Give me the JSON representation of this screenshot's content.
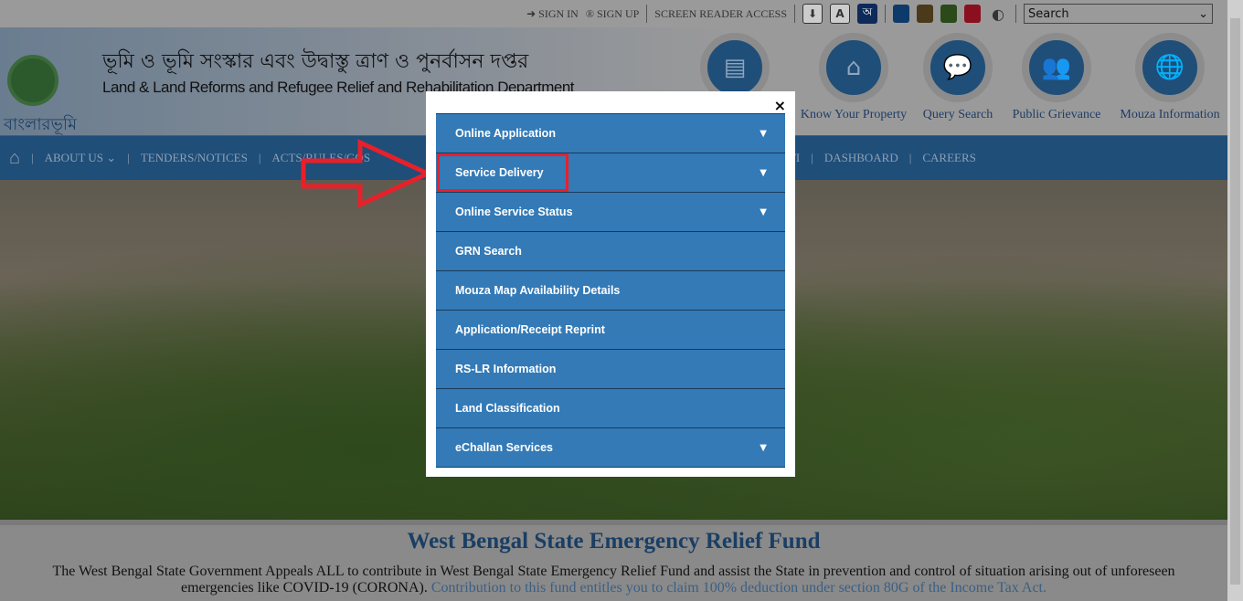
{
  "topbar": {
    "sign_in": "SIGN IN",
    "sign_up": "SIGN UP",
    "screen_reader": "SCREEN READER ACCESS",
    "search_select": "Search",
    "colors": [
      "#0d3a6b",
      "#4a3a1a",
      "#2a4a1a",
      "#8a1020"
    ],
    "icons": [
      "download-icon",
      "font-size-icon",
      "translate-icon",
      "contrast-icon"
    ]
  },
  "header": {
    "logo_text": "বাংলারভূমি",
    "bengali_title": "ভূমি ও ভূমি সংস্কার এবং উদ্বাস্তু ত্রাণ ও পুনর্বাসন দপ্তর",
    "english_title": "Land & Land Reforms and Refugee Relief and Rehabilitation Department"
  },
  "quick_links": [
    {
      "label": "",
      "icon": "id-card-icon"
    },
    {
      "label": "Know Your Property",
      "icon": "home-icon"
    },
    {
      "label": "Query Search",
      "icon": "chat-icon"
    },
    {
      "label": "Public Grievance",
      "icon": "users-icon"
    },
    {
      "label": "Mouza Information",
      "icon": "globe-icon"
    }
  ],
  "nav": {
    "items": [
      "ABOUT US",
      "TENDERS/NOTICES",
      "ACTS/RULES/GOS",
      "RTI",
      "DASHBOARD",
      "CAREERS"
    ]
  },
  "modal": {
    "close": "×",
    "items": [
      {
        "label": "Online Application",
        "has_submenu": true
      },
      {
        "label": "Service Delivery",
        "has_submenu": true,
        "highlighted": true
      },
      {
        "label": "Online Service Status",
        "has_submenu": true
      },
      {
        "label": "GRN Search",
        "has_submenu": false
      },
      {
        "label": "Mouza Map Availability Details",
        "has_submenu": false
      },
      {
        "label": "Application/Receipt Reprint",
        "has_submenu": false
      },
      {
        "label": "RS-LR Information",
        "has_submenu": false
      },
      {
        "label": "Land Classification",
        "has_submenu": false
      },
      {
        "label": "eChallan Services",
        "has_submenu": true
      }
    ]
  },
  "relief": {
    "title": "West Bengal State Emergency Relief Fund",
    "text": "The West Bengal State Government Appeals ALL to contribute in West Bengal State Emergency Relief Fund and assist the State in prevention and control of situation arising out of unforeseen emergencies like COVID-19 (CORONA).",
    "link": " Contribution to this fund entitles you to claim 100% deduction under section 80G of the Income Tax Act."
  },
  "accent": "#337ab7",
  "highlight_color": "#e8202a"
}
